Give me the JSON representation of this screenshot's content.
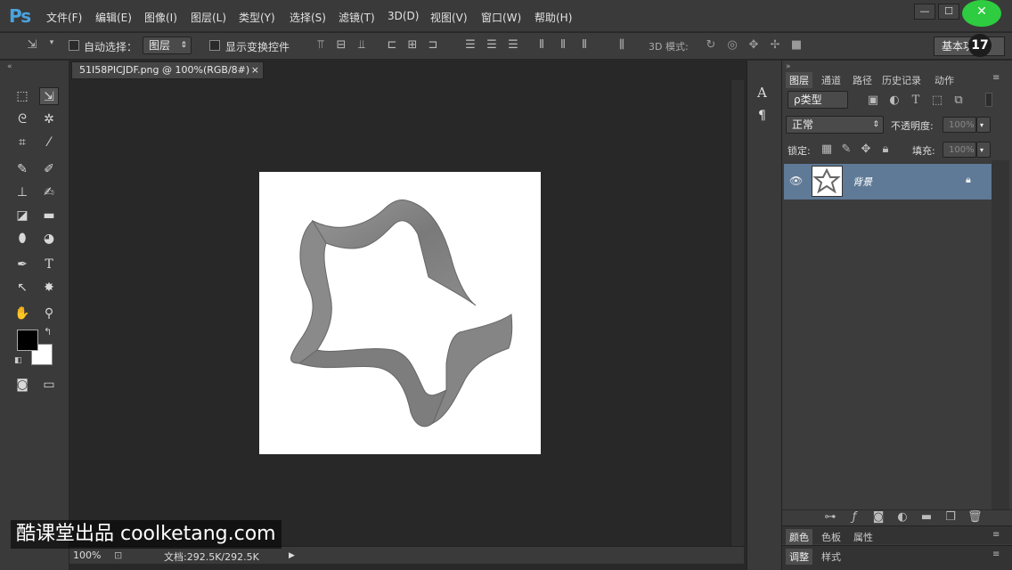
{
  "app": {
    "logo": "Ps"
  },
  "menu": [
    "文件(F)",
    "编辑(E)",
    "图像(I)",
    "图层(L)",
    "类型(Y)",
    "选择(S)",
    "滤镜(T)",
    "3D(D)",
    "视图(V)",
    "窗口(W)",
    "帮助(H)"
  ],
  "window_controls": {
    "minimize": "—",
    "maximize": "☐",
    "close": "✕"
  },
  "options": {
    "auto_select_label": "自动选择：",
    "auto_select_value": "图层",
    "show_transform_label": "显示变换控件",
    "mode_3d_label": "3D 模式:",
    "workspace": "基本功",
    "badge": "17"
  },
  "document": {
    "tab_title": "51I58PICJDF.png @ 100%(RGB/8#)",
    "tab_close": "×"
  },
  "status": {
    "zoom": "100%",
    "doc_size": "文档:292.5K/292.5K",
    "arrow": "▶"
  },
  "panels": {
    "tabs": [
      "图层",
      "通道",
      "路径",
      "历史记录",
      "动作"
    ],
    "filter_kind": "ρ类型",
    "blend_mode": "正常",
    "opacity_label": "不透明度:",
    "opacity_value": "100%",
    "lock_label": "锁定:",
    "fill_label": "填充:",
    "fill_value": "100%",
    "layer_name": "背景",
    "bottom_tabs1": [
      "颜色",
      "色板",
      "属性"
    ],
    "bottom_tabs2": [
      "调整",
      "样式"
    ]
  },
  "watermark": "酷课堂出品 coolketang.com"
}
